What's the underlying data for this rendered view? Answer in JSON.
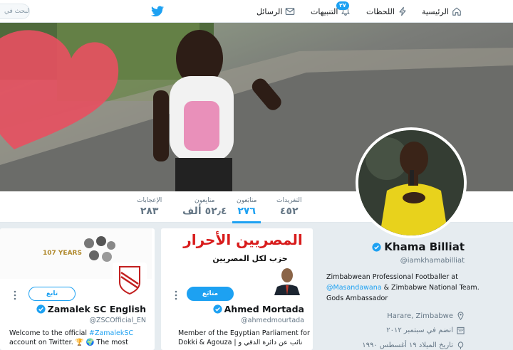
{
  "search": {
    "placeholder": "البحث في"
  },
  "nav": {
    "home": "الرئيسية",
    "moments": "اللحظات",
    "notifications": "التنبيهات",
    "notifications_badge": "٢٧",
    "messages": "الرسائل"
  },
  "stats": [
    {
      "label": "التغريدات",
      "value": "٤٥٢"
    },
    {
      "label": "متابَعون",
      "value": "٢٧٦"
    },
    {
      "label": "متابِعون",
      "value": "٥٢٫٤ ألف"
    },
    {
      "label": "الإعجابات",
      "value": "٢٨٣"
    }
  ],
  "profile": {
    "name": "Khama Billiat",
    "handle": "@iamkhamabilliat",
    "bio_pre": "Zimbabwean Professional Footballer at ",
    "bio_mention": "@Masandawana",
    "bio_post": " & Zimbabwe National Team. Gods Ambassador",
    "location": "Harare, Zimbabwe",
    "joined": "انضم في سبتمبر ٢٠١٢",
    "birthday": "تاريخ الميلاد ١٩ أغسطس ١٩٩٠"
  },
  "cards": {
    "mortada": {
      "name": "Ahmed Mortada",
      "handle": "@ahmedmourtada",
      "button": "متابَع",
      "bio": "Member of the Egyptian Parliament for Dokki & Agouza | نائب عن دائرة الدقي و",
      "banner_line1": "المصريين الأحرار",
      "banner_line2": "حزب لكل المصريين"
    },
    "zamalek": {
      "name": "Zamalek SC English",
      "handle": "@ZSCOfficial_EN",
      "button": "تابع",
      "bio_pre": "Welcome to the official ",
      "bio_tag": "#ZamalekSC",
      "bio_post": " account on Twitter. 🏆 🌍 The most",
      "banner_text": "107 YEARS"
    }
  }
}
